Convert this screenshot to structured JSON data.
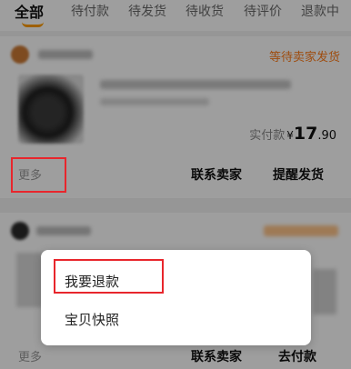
{
  "tabs": [
    {
      "label": "全部",
      "active": true
    },
    {
      "label": "待付款"
    },
    {
      "label": "待发货"
    },
    {
      "label": "待收货"
    },
    {
      "label": "待评价"
    },
    {
      "label": "退款中"
    }
  ],
  "order1": {
    "status": "等待卖家发货",
    "price_label": "实付款",
    "currency": "¥",
    "price_int": "17",
    "price_dec": ".90",
    "more_label": "更多",
    "contact_label": "联系卖家",
    "remind_label": "提醒发货"
  },
  "order2": {
    "more_label": "更多",
    "contact_label": "联系卖家",
    "cancel_label": "去付款"
  },
  "popup": {
    "items": [
      {
        "label": "我要退款"
      },
      {
        "label": "宝贝快照"
      }
    ]
  },
  "colors": {
    "accent": "#ff7d1a",
    "highlight_box": "#e8262c"
  }
}
